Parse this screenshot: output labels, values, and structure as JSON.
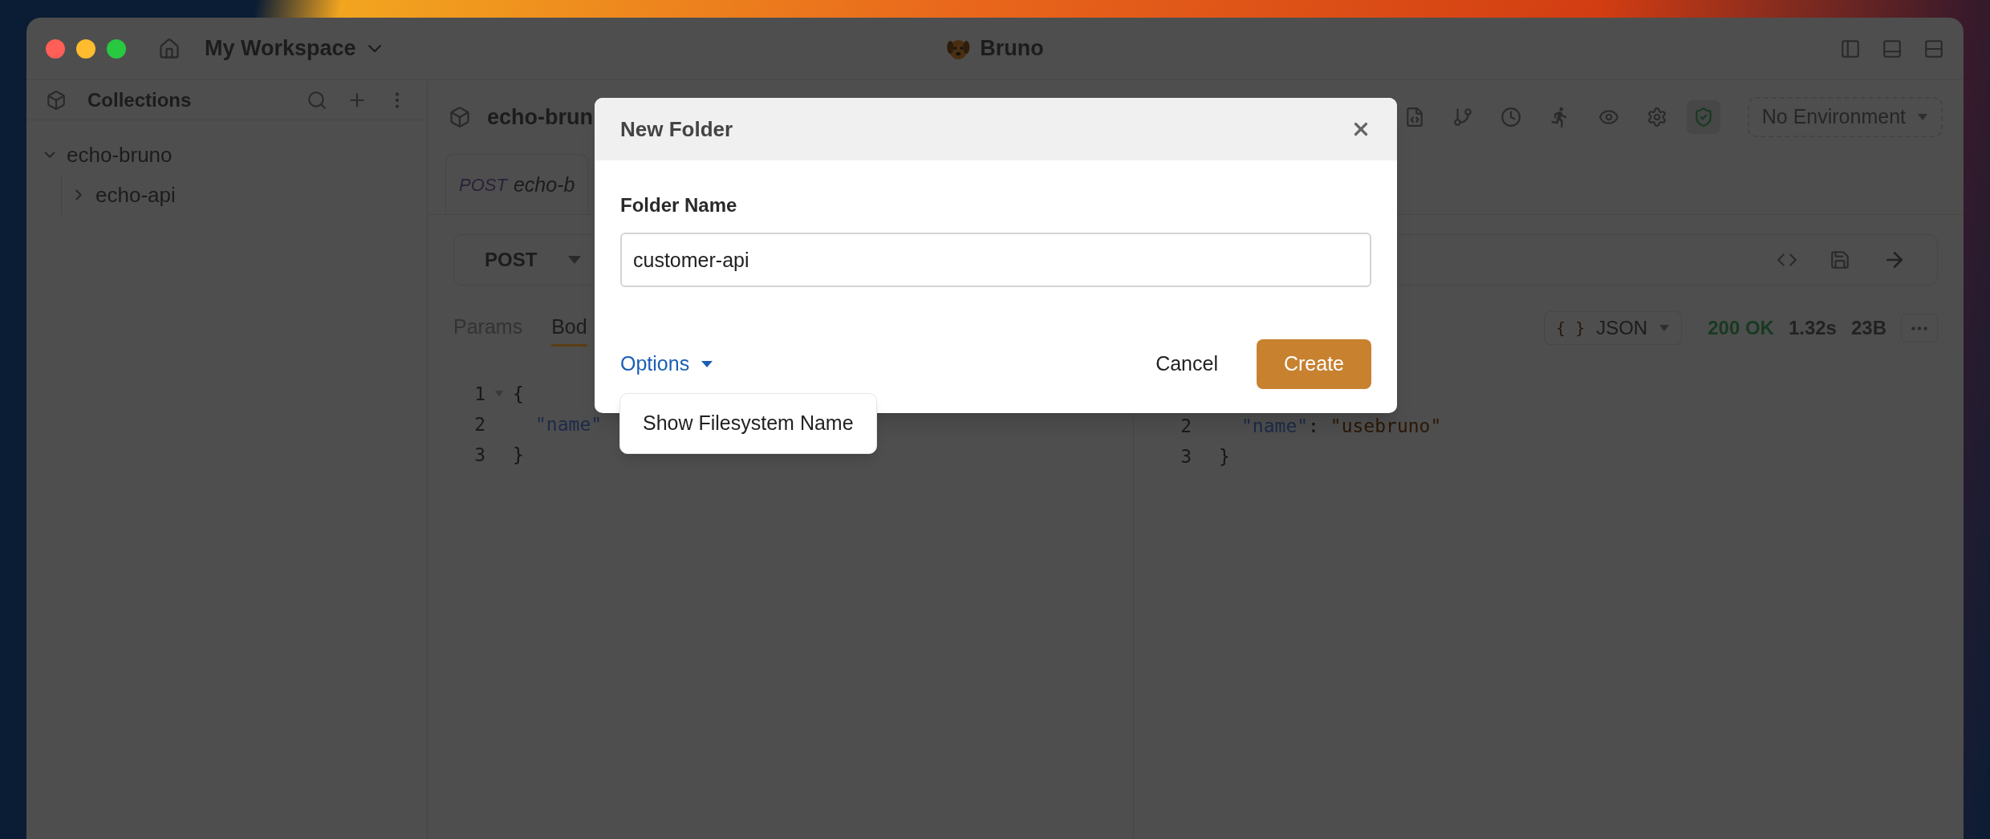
{
  "window": {
    "title": "Bruno",
    "workspace": "My Workspace"
  },
  "sidebar": {
    "title": "Collections",
    "tree": [
      {
        "label": "echo-bruno",
        "expanded": true,
        "children": [
          {
            "label": "echo-api",
            "expanded": false
          }
        ]
      }
    ]
  },
  "collection_header": {
    "title": "echo-brun",
    "environment": "No Environment"
  },
  "request_tab": {
    "method": "POST",
    "name": "echo-b"
  },
  "url_bar": {
    "method": "POST"
  },
  "request_tabs": [
    {
      "label": "Params",
      "selected": false
    },
    {
      "label": "Bod",
      "selected": true
    }
  ],
  "request_body": [
    {
      "line": "1",
      "foldable": true,
      "tokens": [
        {
          "text": "{",
          "kind": "punct"
        }
      ]
    },
    {
      "line": "2",
      "foldable": false,
      "tokens": [
        {
          "text": "\"name\"",
          "kind": "key"
        }
      ]
    },
    {
      "line": "3",
      "foldable": false,
      "tokens": [
        {
          "text": "}",
          "kind": "punct"
        }
      ]
    }
  ],
  "response": {
    "format_icon": "{ }",
    "format": "JSON",
    "status": "200 OK",
    "time": "1.32s",
    "size": "23B",
    "lines": [
      {
        "line": "2",
        "tokens": [
          {
            "text": "\"name\"",
            "kind": "key"
          },
          {
            "text": ": ",
            "kind": "punct"
          },
          {
            "text": "\"usebruno\"",
            "kind": "string"
          }
        ]
      },
      {
        "line": "3",
        "tokens": [
          {
            "text": "}",
            "kind": "punct"
          }
        ]
      }
    ]
  },
  "dialog": {
    "title": "New Folder",
    "label": "Folder Name",
    "value": "customer-api",
    "options": "Options",
    "menu_items": [
      "Show Filesystem Name"
    ],
    "buttons": [
      {
        "label": "Cancel",
        "kind": "secondary"
      },
      {
        "label": "Create",
        "kind": "primary"
      }
    ]
  }
}
